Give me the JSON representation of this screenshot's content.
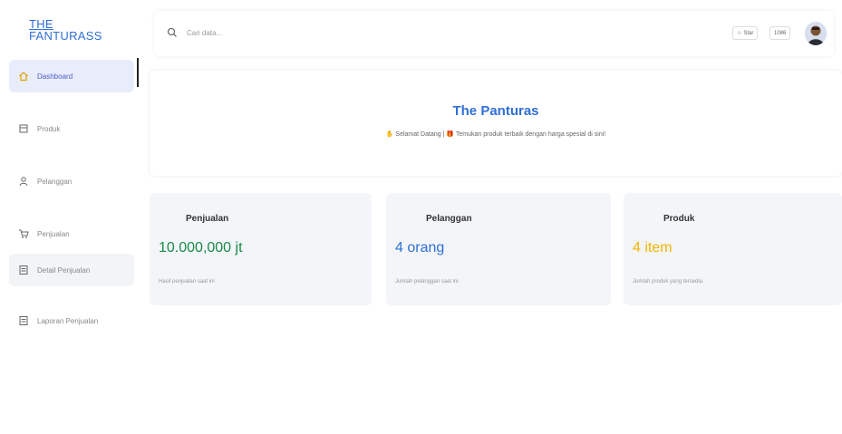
{
  "brand": {
    "line1": "THE",
    "line2": "FANTURASS",
    "color": "#2f6fd6"
  },
  "sidebar": {
    "items": [
      {
        "label": "Dashboard",
        "icon": "home-icon"
      },
      {
        "label": "Produk",
        "icon": "box-icon"
      },
      {
        "label": "Pelanggan",
        "icon": "user-icon"
      },
      {
        "label": "Penjualan",
        "icon": "cart-icon"
      },
      {
        "label": "Detail Penjualan",
        "icon": "receipt-icon"
      },
      {
        "label": "Laporan Penjualan",
        "icon": "report-icon"
      }
    ]
  },
  "search": {
    "placeholder": "Cari data..."
  },
  "header": {
    "star_label": "Star",
    "small_label": "1086"
  },
  "banner": {
    "title": "The Panturas",
    "subtitle_a": " Selamat Datang | ",
    "subtitle_b": " Temukan produk terbaik dengan harga spesial di sini!"
  },
  "cards": [
    {
      "title": "Penjualan",
      "value": "10.000,000 jt",
      "note": "Hasil penjualan saat ini",
      "color": "#1a8a4a"
    },
    {
      "title": "Pelanggan",
      "value": "4 orang",
      "note": "Jumlah pelanggan saat ini",
      "color": "#2f6fd6"
    },
    {
      "title": "Produk",
      "value": "4 item",
      "note": "Jumlah produk yang tersedia",
      "color": "#f5b400"
    }
  ],
  "colors": {
    "accent": "#2f6fd6",
    "active_bg": "#e9ecfb"
  }
}
